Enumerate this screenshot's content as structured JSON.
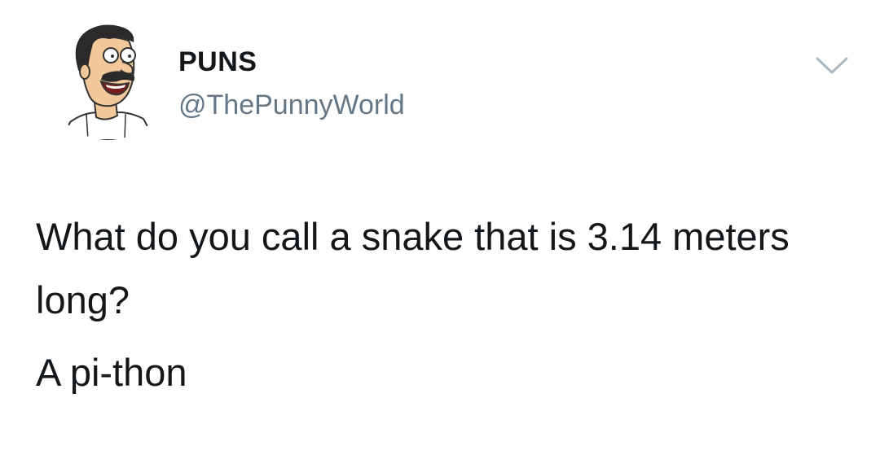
{
  "author": {
    "display_name": "PUNS",
    "handle": "@ThePunnyWorld",
    "avatar_icon": "cartoon-character-avatar"
  },
  "menu": {
    "icon": "chevron-down-icon",
    "color": "#aab8c2"
  },
  "tweet": {
    "question": "What do you call a snake that is 3.14 meters long?",
    "answer": "A pi-thon"
  },
  "colors": {
    "text": "#14171a",
    "handle": "#657786"
  }
}
